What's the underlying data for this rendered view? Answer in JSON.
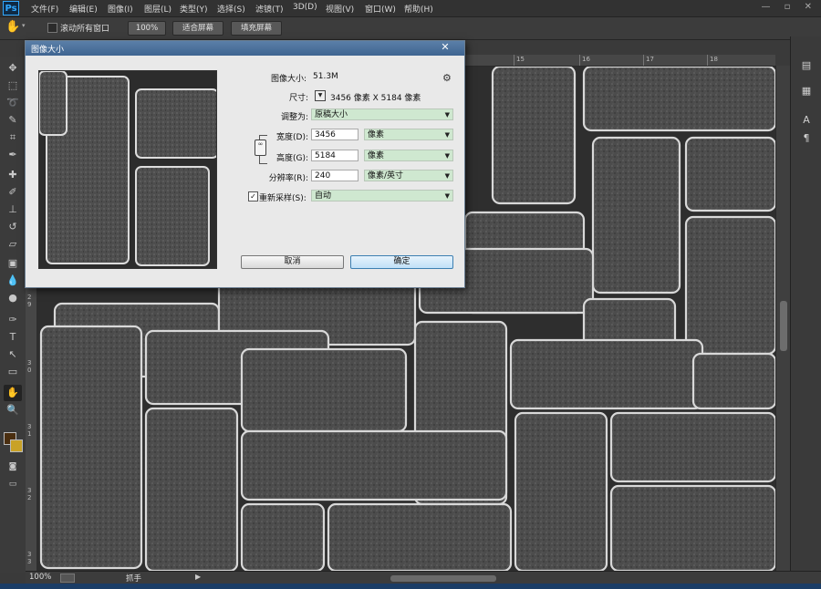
{
  "app": {
    "logo": "Ps"
  },
  "menubar": {
    "items": [
      "文件(F)",
      "编辑(E)",
      "图像(I)",
      "图层(L)",
      "类型(Y)",
      "选择(S)",
      "滤镜(T)",
      "3D(D)",
      "视图(V)",
      "窗口(W)",
      "帮助(H)"
    ],
    "window_controls": "— ▫ ✕"
  },
  "options_bar": {
    "scroll_all_label": "滚动所有窗口",
    "zoom_button": "100%",
    "fit_screen_button": "适合屏幕",
    "fill_screen_button": "填充屏幕"
  },
  "rulers": {
    "top_ticks": [
      "15",
      "16",
      "17",
      "18"
    ],
    "left_ticks": [
      "2\n9",
      "3\n0",
      "3\n1",
      "3\n2",
      "3\n3"
    ]
  },
  "status": {
    "zoom": "100%",
    "doc_info": "抓手"
  },
  "dialog": {
    "title": "图像大小",
    "close": "✕",
    "image_size_label": "图像大小:",
    "image_size_value": "51.3M",
    "dimensions_label": "尺寸:",
    "dimensions_value": "3456 像素  X  5184 像素",
    "fit_to_label": "调整为:",
    "fit_to_value": "原稿大小",
    "width_label": "宽度(D):",
    "width_value": "3456",
    "width_unit": "像素",
    "height_label": "高度(G):",
    "height_value": "5184",
    "height_unit": "像素",
    "resolution_label": "分辨率(R):",
    "resolution_value": "240",
    "resolution_unit": "像素/英寸",
    "resample_label": "重新采样(S):",
    "resample_checked": "✓",
    "resample_value": "自动",
    "cancel_button": "取消",
    "ok_button": "确定"
  },
  "icons": {
    "gear": "gear-icon",
    "chain": "chain-link-icon",
    "hand": "hand-tool-icon"
  },
  "colors": {
    "foreground": "#4a2e10",
    "background": "#c9a227",
    "accent_select": "#cfe8d0"
  }
}
